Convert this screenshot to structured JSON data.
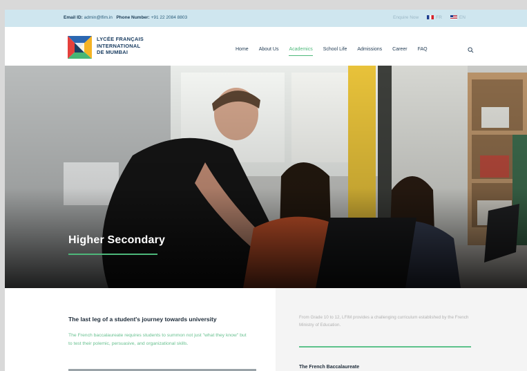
{
  "topbar": {
    "email_label": "Email ID:",
    "email_value": "admin@lfim.in",
    "phone_label": "Phone Number:",
    "phone_value": "+91 22 2084 8803",
    "enquire": "Enquire Now",
    "lang_fr": "FR",
    "lang_en": "EN"
  },
  "brand": {
    "line1": "LYCÉE FRANÇAIS",
    "line2": "INTERNATIONAL",
    "line3": "DE MUMBAI"
  },
  "nav": {
    "items": [
      {
        "label": "Home"
      },
      {
        "label": "About Us"
      },
      {
        "label": "Academics"
      },
      {
        "label": "School Life"
      },
      {
        "label": "Admissions"
      },
      {
        "label": "Career"
      },
      {
        "label": "FAQ"
      }
    ],
    "active": "Academics"
  },
  "hero": {
    "title": "Higher Secondary"
  },
  "content": {
    "heading": "The last leg of a student's journey towards university",
    "lead": "The French baccalaureate requires students to summon not just \"what they know\" but to test their polemic, persuasive, and organizational skills.",
    "right_text": "From Grade 10 to 12, LFIM provides a challenging curriculum established by the French Ministry of Education.",
    "sub_heading": "The French Baccalaureate"
  },
  "colors": {
    "accent": "#4db87a",
    "topbar": "#cfe6ef",
    "navy": "#1c3f63"
  },
  "icons": [
    "logo-mark",
    "search-icon",
    "flag-fr-icon",
    "flag-en-icon"
  ]
}
